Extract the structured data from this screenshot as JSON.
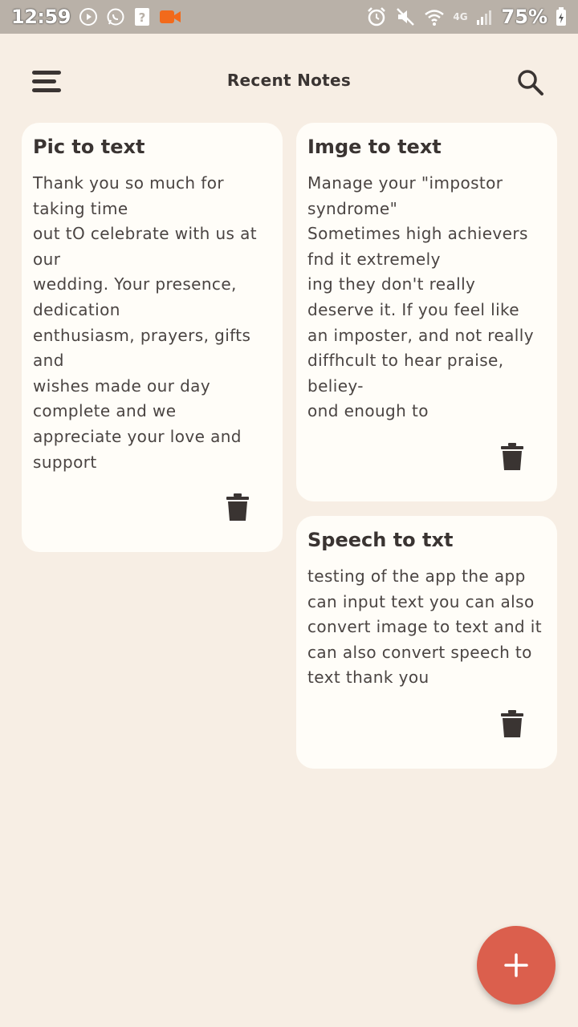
{
  "status_bar": {
    "time": "12:59",
    "network": "4G",
    "battery": "75%",
    "left_icons": [
      "play-icon",
      "whatsapp-icon",
      "unknown-file-icon",
      "video-camera-icon"
    ],
    "right_icons": [
      "alarm-icon",
      "mute-icon",
      "wifi-icon",
      "signal-icon",
      "battery-charging-icon"
    ]
  },
  "header": {
    "title": "Recent Notes",
    "menu_icon": "menu-icon",
    "search_icon": "search-icon"
  },
  "notes": [
    {
      "title": "Pic to text",
      "body": "Thank you so much for\ntaking time\nout tO celebrate with us at\nour\nwedding. Your presence,\ndedication\nenthusiasm, prayers, gifts\nand\nwishes made our day\ncomplete and we\nappreciate your love and\nsupport"
    },
    {
      "title": "Imge to text",
      "body": "Manage your \"impostor\nsyndrome\"\nSometimes high achievers\nfnd it extremely\ning they don't really\ndeserve it. If you feel like\nan imposter, and not really\ndiffhcult to hear praise,\nbeliey-\nond enough to"
    },
    {
      "title": "Speech to txt",
      "body": "testing of the app the app\ncan input text you can also\nconvert image to text and it\ncan also convert speech to\ntext thank you"
    }
  ],
  "fab": {
    "icon": "plus-icon"
  },
  "colors": {
    "background": "#f7eee4",
    "card": "#fffdf8",
    "text": "#3a3432",
    "fab": "#db5f4d",
    "status_bar": "#b9b1a8",
    "video_icon": "#f26a1b"
  }
}
